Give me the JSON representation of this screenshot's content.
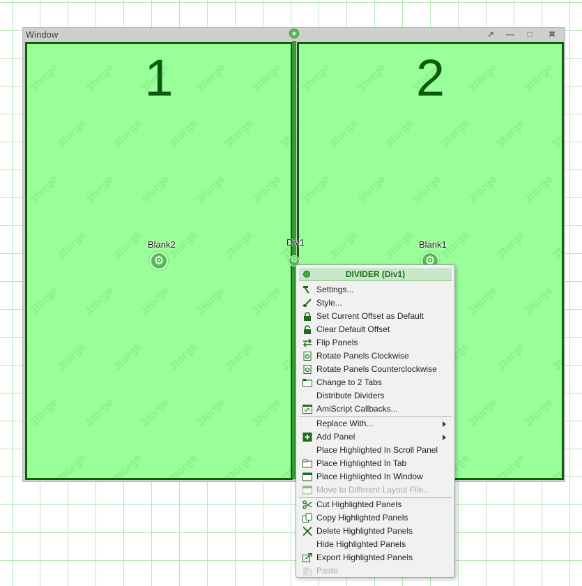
{
  "window": {
    "title": "Window",
    "buttons": [
      "expand-icon",
      "minimize-icon",
      "maximize-icon",
      "close-icon"
    ]
  },
  "panels": [
    {
      "number": "1",
      "label": "Blank2"
    },
    {
      "number": "2",
      "label": "Blank1"
    }
  ],
  "divider": {
    "label": "Div1"
  },
  "watermark": "3forge",
  "context_menu": {
    "header": "DIVIDER (Div1)",
    "groups": [
      [
        {
          "label": "Settings...",
          "icon": "hammer-icon"
        },
        {
          "label": "Style...",
          "icon": "brush-icon"
        },
        {
          "label": "Set Current Offset as Default",
          "icon": "lock-icon"
        },
        {
          "label": "Clear Default Offset",
          "icon": "unlock-icon"
        },
        {
          "label": "Flip Panels",
          "icon": "swap-arrows-icon"
        },
        {
          "label": "Rotate Panels Clockwise",
          "icon": "rotate-cw-icon"
        },
        {
          "label": "Rotate Panels Counterclockwise",
          "icon": "rotate-ccw-icon"
        },
        {
          "label": "Change to 2 Tabs",
          "icon": "tabs-icon"
        },
        {
          "label": "Distribute Dividers",
          "icon": ""
        },
        {
          "label": "AmiScript Callbacks...",
          "icon": "script-icon"
        }
      ],
      [
        {
          "label": "Replace With...",
          "icon": "",
          "submenu": true
        },
        {
          "label": "Add Panel",
          "icon": "plus-icon",
          "submenu": true
        },
        {
          "label": "Place Highlighted In Scroll Panel",
          "icon": ""
        },
        {
          "label": "Place Highlighted In Tab",
          "icon": "folder-tab-icon"
        },
        {
          "label": "Place Highlighted In Window",
          "icon": "window-icon"
        },
        {
          "label": "Move to Different Layout File...",
          "icon": "window-icon",
          "disabled": true
        }
      ],
      [
        {
          "label": "Cut Highlighted Panels",
          "icon": "scissors-icon"
        },
        {
          "label": "Copy Highlighted Panels",
          "icon": "copy-icon"
        },
        {
          "label": "Delete Highlighted Panels",
          "icon": "x-icon"
        },
        {
          "label": "Hide Highlighted Panels",
          "icon": ""
        },
        {
          "label": "Export Highlighted Panels",
          "icon": "export-icon"
        },
        {
          "label": "Paste",
          "icon": "paste-icon",
          "disabled": true
        }
      ]
    ]
  }
}
